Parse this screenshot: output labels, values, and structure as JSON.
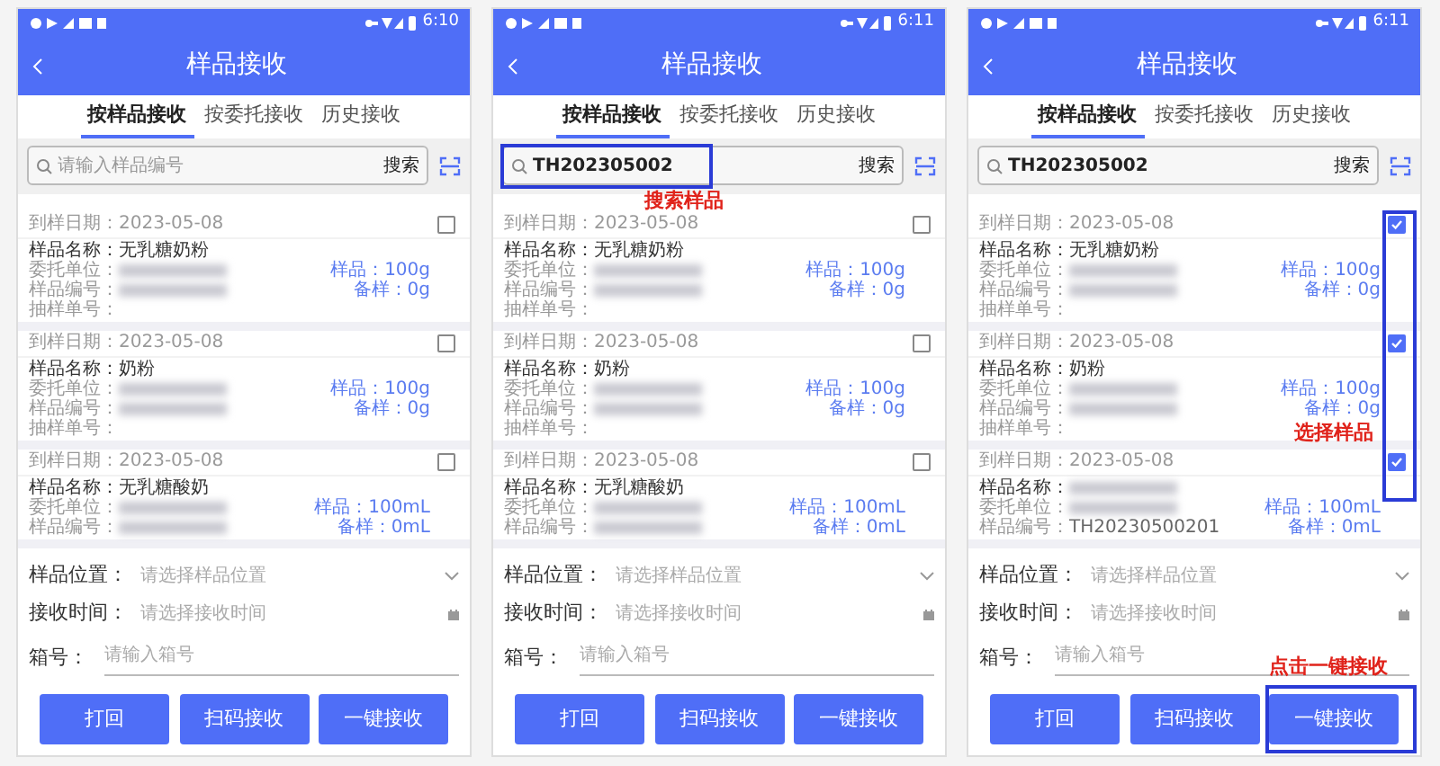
{
  "phones": [
    {
      "status_time": "6:10",
      "title": "样品接收",
      "tabs": [
        {
          "label": "按样品接收",
          "selected": true
        },
        {
          "label": "按委托接收",
          "selected": false
        },
        {
          "label": "历史接收",
          "selected": false
        }
      ],
      "search": {
        "placeholder": "请输入样品编号",
        "button": "搜索"
      },
      "items": [
        {
          "checked": false,
          "date_label": "到样日期：",
          "date": "2023-05-08",
          "name_label": "样品名称：",
          "name": "无乳糖奶粉",
          "fields": [
            {
              "label": "委托单位：",
              "blurred": true
            },
            {
              "label": "样品编号：",
              "blurred": true
            },
            {
              "label": "抽样单号："
            }
          ],
          "amounts": [
            "样品：100g",
            "备样：0g"
          ]
        },
        {
          "checked": false,
          "date_label": "到样日期：",
          "date": "2023-05-08",
          "name_label": "样品名称：",
          "name": "奶粉",
          "fields": [
            {
              "label": "委托单位：",
              "blurred": true
            },
            {
              "label": "样品编号：",
              "blurred": true
            },
            {
              "label": "抽样单号："
            }
          ],
          "amounts": [
            "样品：100g",
            "备样：0g"
          ]
        },
        {
          "checked": false,
          "date_label": "到样日期：",
          "date": "2023-05-08",
          "name_label": "样品名称：",
          "name": "无乳糖酸奶",
          "fields": [
            {
              "label": "委托单位：",
              "blurred": true
            },
            {
              "label": "样品编号：",
              "blurred": true
            }
          ],
          "amounts": [
            "样品：100mL",
            "备样：0mL"
          ]
        }
      ],
      "form": [
        {
          "kind": "select",
          "label": "样品位置：",
          "placeholder": "请选择样品位置"
        },
        {
          "kind": "date",
          "label": "接收时间：",
          "placeholder": "请选择接收时间"
        },
        {
          "kind": "input",
          "label": "箱号：",
          "placeholder": "请输入箱号"
        }
      ],
      "buttons": [
        "打回",
        "扫码接收",
        "一键接收"
      ]
    },
    {
      "status_time": "6:11",
      "title": "样品接收",
      "tabs": [
        {
          "label": "按样品接收",
          "selected": true
        },
        {
          "label": "按委托接收",
          "selected": false
        },
        {
          "label": "历史接收",
          "selected": false
        }
      ],
      "search": {
        "value": "TH202305002",
        "button": "搜索"
      },
      "items": [
        {
          "checked": false,
          "date_label": "到样日期：",
          "date": "2023-05-08",
          "name_label": "样品名称：",
          "name": "无乳糖奶粉",
          "fields": [
            {
              "label": "委托单位：",
              "blurred": true
            },
            {
              "label": "样品编号：",
              "blurred": true
            },
            {
              "label": "抽样单号："
            }
          ],
          "amounts": [
            "样品：100g",
            "备样：0g"
          ]
        },
        {
          "checked": false,
          "date_label": "到样日期：",
          "date": "2023-05-08",
          "name_label": "样品名称：",
          "name": "奶粉",
          "fields": [
            {
              "label": "委托单位：",
              "blurred": true
            },
            {
              "label": "样品编号：",
              "blurred": true
            },
            {
              "label": "抽样单号："
            }
          ],
          "amounts": [
            "样品：100g",
            "备样：0g"
          ]
        },
        {
          "checked": false,
          "date_label": "到样日期：",
          "date": "2023-05-08",
          "name_label": "样品名称：",
          "name": "无乳糖酸奶",
          "fields": [
            {
              "label": "委托单位：",
              "blurred": true
            },
            {
              "label": "样品编号：",
              "blurred": true
            }
          ],
          "amounts": [
            "样品：100mL",
            "备样：0mL"
          ]
        }
      ],
      "form": [
        {
          "kind": "select",
          "label": "样品位置：",
          "placeholder": "请选择样品位置"
        },
        {
          "kind": "date",
          "label": "接收时间：",
          "placeholder": "请选择接收时间"
        },
        {
          "kind": "input",
          "label": "箱号：",
          "placeholder": "请输入箱号"
        }
      ],
      "buttons": [
        "打回",
        "扫码接收",
        "一键接收"
      ],
      "annotations": [
        {
          "kind": "search",
          "label": "搜索样品"
        }
      ]
    },
    {
      "status_time": "6:11",
      "title": "样品接收",
      "tabs": [
        {
          "label": "按样品接收",
          "selected": true
        },
        {
          "label": "按委托接收",
          "selected": false
        },
        {
          "label": "历史接收",
          "selected": false
        }
      ],
      "search": {
        "value": "TH202305002",
        "button": "搜索"
      },
      "items": [
        {
          "checked": true,
          "date_label": "到样日期：",
          "date": "2023-05-08",
          "name_label": "样品名称：",
          "name": "无乳糖奶粉",
          "fields": [
            {
              "label": "委托单位：",
              "blurred": true
            },
            {
              "label": "样品编号：",
              "blurred": true
            },
            {
              "label": "抽样单号："
            }
          ],
          "amounts": [
            "样品：100g",
            "备样：0g"
          ]
        },
        {
          "checked": true,
          "date_label": "到样日期：",
          "date": "2023-05-08",
          "name_label": "样品名称：",
          "name": "奶粉",
          "fields": [
            {
              "label": "委托单位：",
              "blurred": true
            },
            {
              "label": "样品编号：",
              "blurred": true
            },
            {
              "label": "抽样单号："
            }
          ],
          "amounts": [
            "样品：100g",
            "备样：0g"
          ]
        },
        {
          "checked": true,
          "date_label": "到样日期：",
          "date": "2023-05-08",
          "name_label": "样品名称：",
          "name_blurred": true,
          "fields": [
            {
              "label": "委托单位：",
              "blurred": true
            },
            {
              "label": "样品编号：",
              "value": "TH20230500201"
            }
          ],
          "amounts": [
            "样品：100mL",
            "备样：0mL"
          ]
        }
      ],
      "form": [
        {
          "kind": "select",
          "label": "样品位置：",
          "placeholder": "请选择样品位置"
        },
        {
          "kind": "date",
          "label": "接收时间：",
          "placeholder": "请选择接收时间"
        },
        {
          "kind": "input",
          "label": "箱号：",
          "placeholder": "请输入箱号"
        }
      ],
      "buttons": [
        "打回",
        "扫码接收",
        "一键接收"
      ],
      "annotations": [
        {
          "kind": "checkboxes",
          "label": "选择样品"
        },
        {
          "kind": "confirm",
          "label": "点击一键接收"
        }
      ]
    }
  ]
}
